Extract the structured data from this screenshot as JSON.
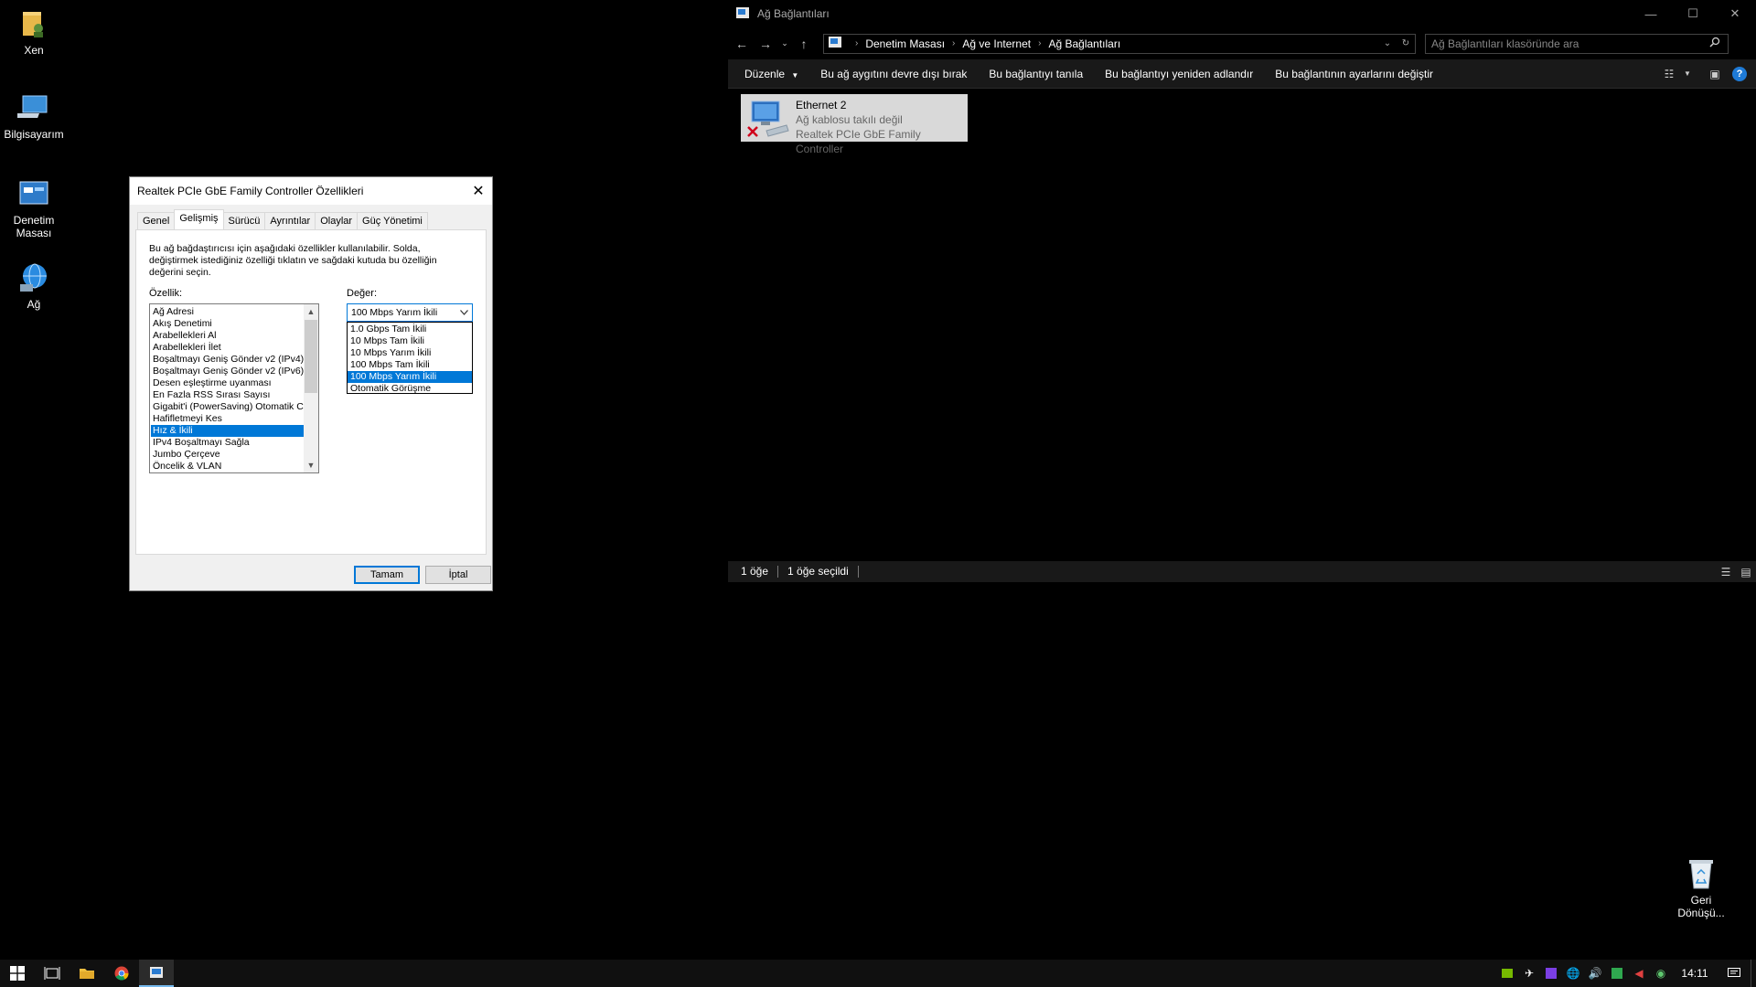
{
  "desktop": {
    "icons": [
      {
        "label": "Xen"
      },
      {
        "label": "Bilgisayarım"
      },
      {
        "label": "Denetim Masası"
      },
      {
        "label": "Ağ"
      }
    ],
    "recycle_bin": "Geri Dönüşü..."
  },
  "dialog": {
    "title": "Realtek PCIe GbE Family Controller Özellikleri",
    "tabs": [
      "Genel",
      "Gelişmiş",
      "Sürücü",
      "Ayrıntılar",
      "Olaylar",
      "Güç Yönetimi"
    ],
    "active_tab": "Gelişmiş",
    "description": "Bu ağ bağdaştırıcısı için aşağıdaki özellikler kullanılabilir. Solda, değiştirmek istediğiniz özelliği tıklatın ve sağdaki kutuda bu özelliğin değerini seçin.",
    "property_label": "Özellik:",
    "value_label": "Değer:",
    "properties": [
      "Ağ Adresi",
      "Akış Denetimi",
      "Arabellekleri Al",
      "Arabellekleri İlet",
      "Boşaltmayı Geniş Gönder v2 (IPv4)",
      "Boşaltmayı Geniş Gönder v2 (IPv6)",
      "Desen eşleştirme uyanması",
      "En Fazla RSS Sırası Sayısı",
      "Gigabit'i (PowerSaving) Otomatik C",
      "Hafifletmeyi Kes",
      "Hız & İkili",
      "IPv4 Boşaltmayı Sağla",
      "Jumbo Çerçeve",
      "Öncelik & VLAN"
    ],
    "selected_property": "Hız & İkili",
    "value_current": "100 Mbps Yarım İkili",
    "value_options": [
      "1.0 Gbps Tam İkili",
      "10 Mbps Tam İkili",
      "10 Mbps Yarım İkili",
      "100 Mbps Tam İkili",
      "100 Mbps Yarım İkili",
      "Otomatik Görüşme"
    ],
    "ok_label": "Tamam",
    "cancel_label": "İptal"
  },
  "explorer": {
    "title": "Ağ Bağlantıları",
    "breadcrumb": [
      "Denetim Masası",
      "Ağ ve Internet",
      "Ağ Bağlantıları"
    ],
    "search_placeholder": "Ağ Bağlantıları klasöründe ara",
    "commands": [
      "Düzenle",
      "Bu ağ aygıtını devre dışı bırak",
      "Bu bağlantıyı tanıla",
      "Bu bağlantıyı yeniden adlandır",
      "Bu bağlantının ayarlarını değiştir"
    ],
    "connection": {
      "name": "Ethernet 2",
      "status": "Ağ kablosu takılı değil",
      "device": "Realtek PCIe GbE Family Controller"
    },
    "status_items": "1 öğe",
    "status_selected": "1 öğe seçildi"
  },
  "taskbar": {
    "clock": "14:11"
  },
  "colors": {
    "accent": "#0078d7",
    "desktop": "#000000"
  }
}
